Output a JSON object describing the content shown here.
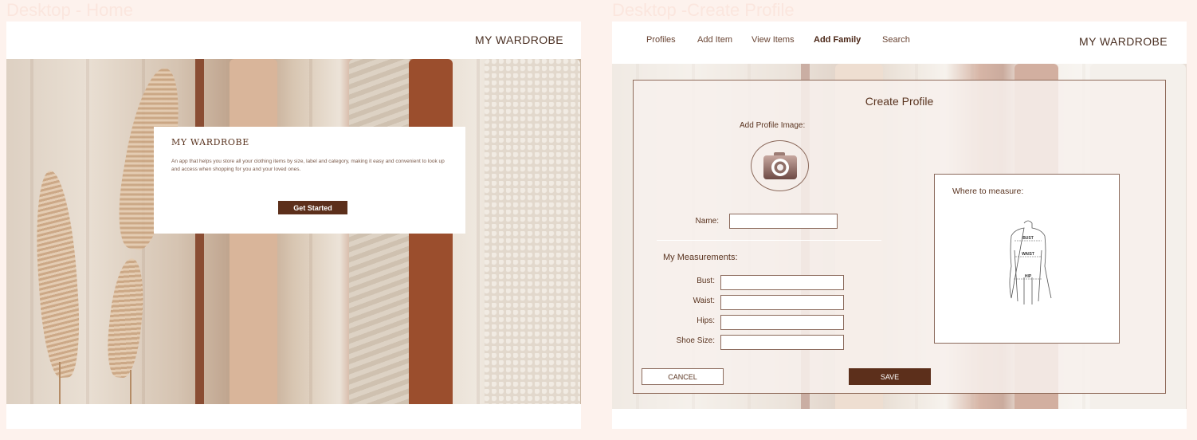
{
  "home": {
    "frame_label": "Desktop - Home",
    "brand": "MY WARDROBE",
    "card": {
      "title": "MY WARDROBE",
      "description": "An app that helps you store all your clothing items by size, label and category, making it easy and convenient  to look up and access when shopping for you and your loved ones.",
      "button": "Get Started"
    }
  },
  "create_profile": {
    "frame_label": "Desktop -Create Profile",
    "brand": "MY WARDROBE",
    "nav": [
      "Profiles",
      "Add Item",
      "View Items",
      "Add Family",
      "Search"
    ],
    "active_nav": "Add Family",
    "title": "Create Profile",
    "add_image_label": "Add Profile Image:",
    "name_label": "Name:",
    "name_value": "",
    "measurements_heading": "My Measurements:",
    "measurements": [
      {
        "label": "Bust:",
        "value": ""
      },
      {
        "label": "Waist:",
        "value": ""
      },
      {
        "label": "Hips:",
        "value": ""
      },
      {
        "label": "Shoe Size:",
        "value": ""
      }
    ],
    "where_to_measure": "Where to measure:",
    "diagram_labels": {
      "bust": "BUST",
      "waist": "WAIST",
      "hip": "HIP"
    },
    "cancel": "CANCEL",
    "save": "SAVE"
  },
  "colors": {
    "accent": "#5c2f1b",
    "page_background": "#fdf2ed",
    "border": "#8b6a5c"
  },
  "icons": [
    "camera-icon"
  ]
}
